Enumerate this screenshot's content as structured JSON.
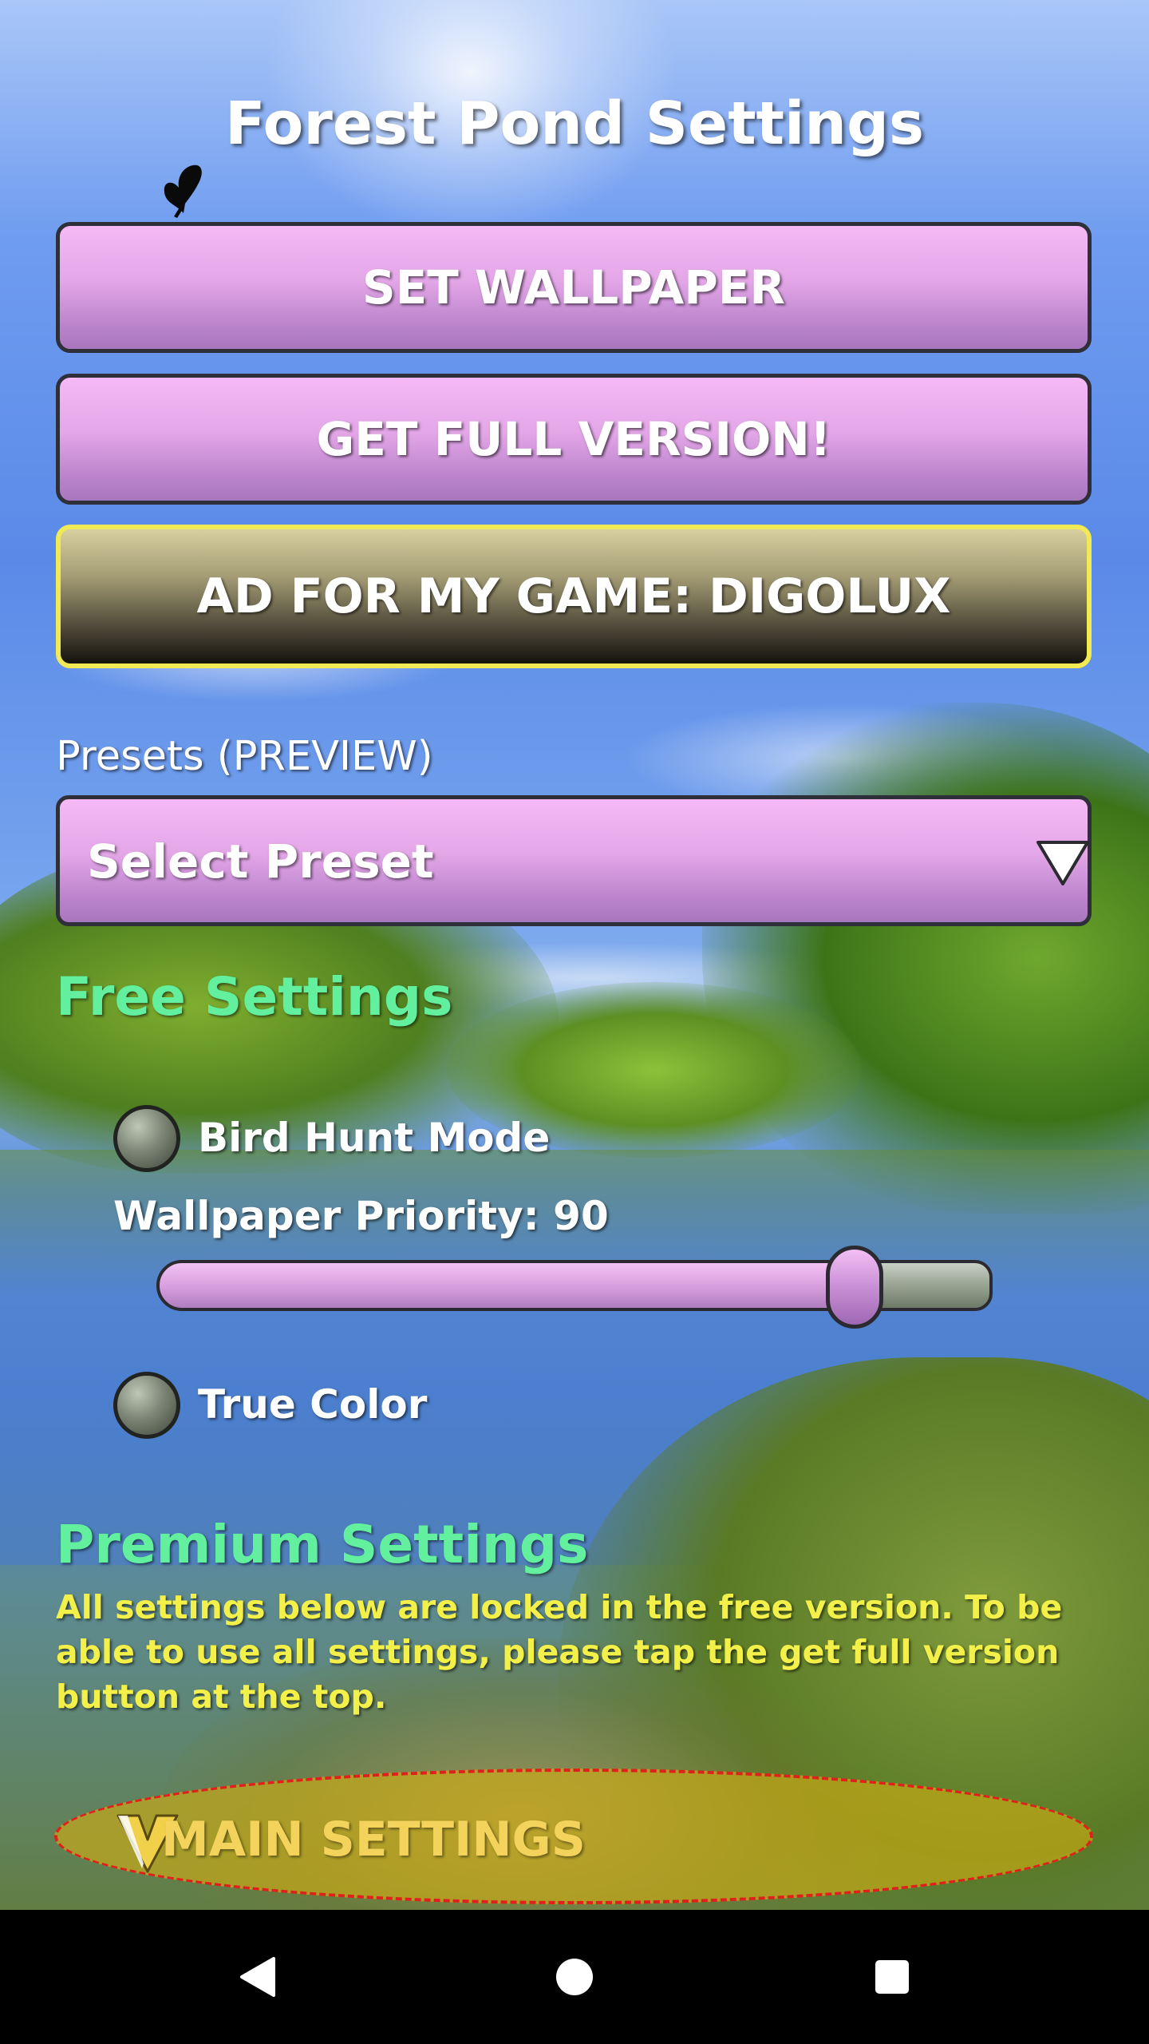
{
  "header": {
    "title": "Forest Pond Settings"
  },
  "buttons": {
    "set_wallpaper": "SET WALLPAPER",
    "get_full_version": "GET FULL VERSION!",
    "ad": "AD FOR MY GAME: DIGOLUX"
  },
  "presets": {
    "label": "Presets (PREVIEW)",
    "selected": "Select Preset"
  },
  "free_settings": {
    "heading": "Free Settings",
    "bird_hunt_mode": "Bird Hunt Mode",
    "wallpaper_priority_label": "Wallpaper Priority: 90",
    "wallpaper_priority_value": 90,
    "wallpaper_priority_fraction": 0.9,
    "true_color": "True Color"
  },
  "premium_settings": {
    "heading": "Premium Settings",
    "description": "All settings below are locked in the free version. To be able to use all settings, please tap the get full version button at the top."
  },
  "main_settings": {
    "label": "MAIN SETTINGS"
  },
  "colors": {
    "section_heading": "#62f09f",
    "premium_text": "#f4f04a",
    "button_purple": "#e3a6e7",
    "ad_border": "#f1ea55",
    "main_settings_border": "#e0201c"
  },
  "icons": {
    "butterfly": "butterfly-icon",
    "dropdown": "triangle-down-icon",
    "main_settings": "chevron-down-icon",
    "nav_back": "back-triangle-icon",
    "nav_home": "home-circle-icon",
    "nav_recents": "recents-square-icon"
  }
}
